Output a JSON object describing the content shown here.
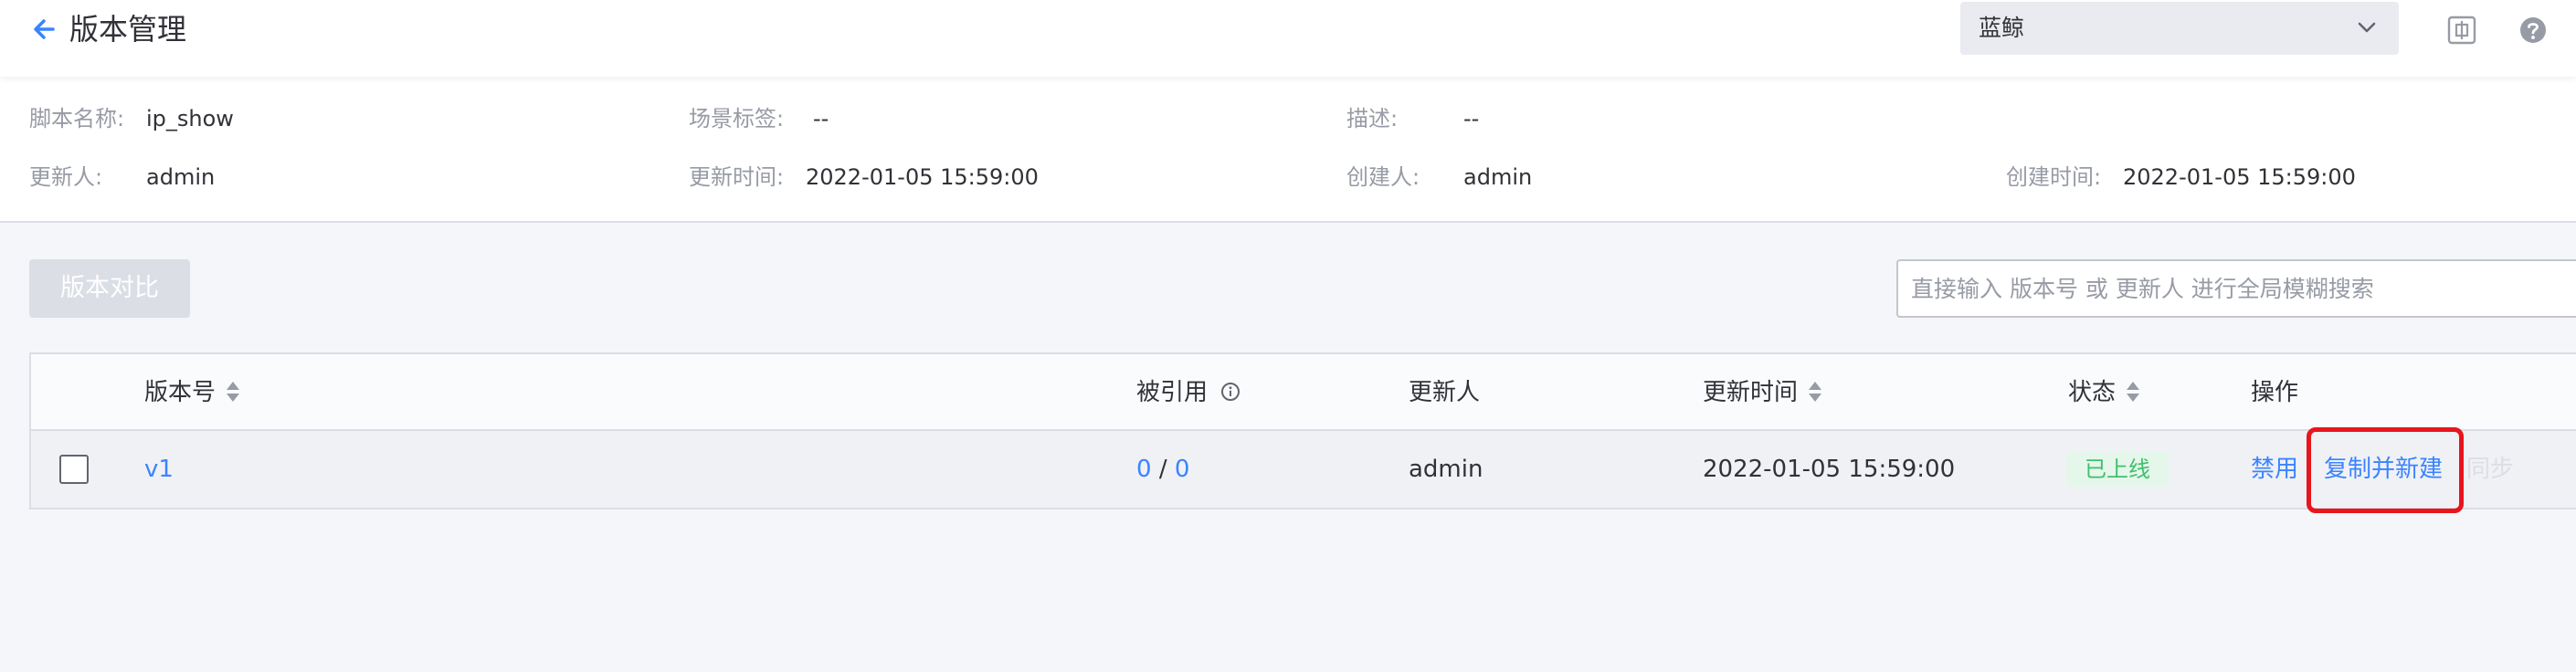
{
  "header": {
    "title": "版本管理",
    "project": "蓝鲸"
  },
  "info": {
    "script_name_label": "脚本名称:",
    "script_name": "ip_show",
    "scene_tag_label": "场景标签:",
    "scene_tag": "--",
    "description_label": "描述:",
    "description": "--",
    "updater_label": "更新人:",
    "updater": "admin",
    "update_time_label": "更新时间:",
    "update_time": "2022-01-05 15:59:00",
    "creator_label": "创建人:",
    "creator": "admin",
    "create_time_label": "创建时间:",
    "create_time": "2022-01-05 15:59:00"
  },
  "toolbar": {
    "compare_label": "版本对比",
    "search_placeholder": "直接输入 版本号 或 更新人 进行全局模糊搜索"
  },
  "table": {
    "columns": {
      "version": "版本号",
      "referenced": "被引用",
      "updater": "更新人",
      "update_time": "更新时间",
      "status": "状态",
      "actions": "操作"
    },
    "rows": [
      {
        "version": "v1",
        "ref_a": "0",
        "ref_sep": "/",
        "ref_b": "0",
        "updater": "admin",
        "update_time": "2022-01-05 15:59:00",
        "status": "已上线",
        "action_disable": "禁用",
        "action_copy": "复制并新建",
        "action_sync": "同步"
      }
    ]
  },
  "icons": {
    "back": "arrow-left-icon",
    "select": "chevron-down-icon",
    "screen": "fullscreen-icon",
    "help": "help-icon",
    "sort": "sort-icon",
    "info": "info-icon"
  },
  "colors": {
    "primary": "#3a84ff",
    "success_bg": "#e5f6ea",
    "success_text": "#3fc06d",
    "highlight": "#e8151d",
    "disabled": "#dcdee5"
  }
}
